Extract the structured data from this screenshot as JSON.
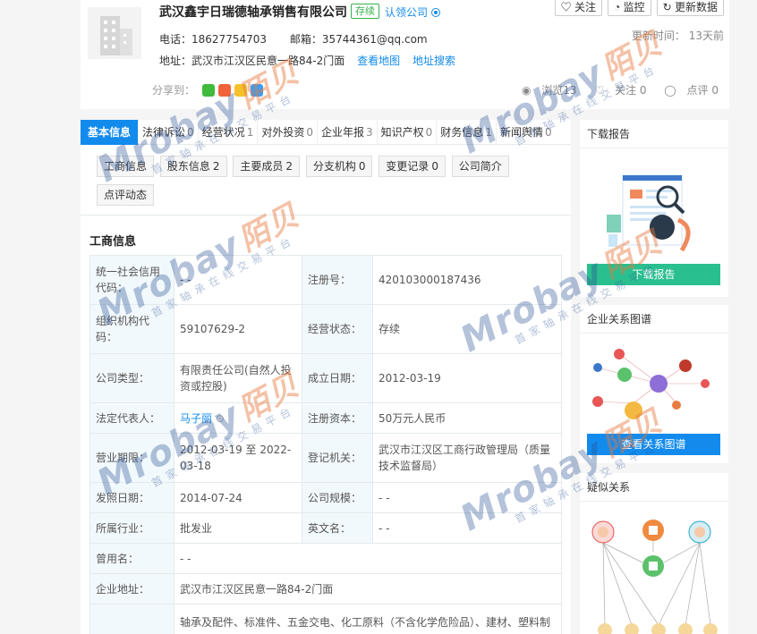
{
  "header": {
    "company_name": "武汉鑫宇日瑞德轴承销售有限公司",
    "status_tag": "存续",
    "claim_label": "认领公司",
    "phone_label": "电话：",
    "phone": "18627754703",
    "email_label": "邮箱：",
    "email": "35744361@qq.com",
    "address_label": "地址：",
    "address": "武汉市江汉区民意一路84-2门面",
    "view_map": "查看地图",
    "address_search": "地址搜索",
    "share_label": "分享到：",
    "buttons": {
      "follow": "关注",
      "monitor": "监控",
      "update": "更新数据"
    },
    "update_time_label": "更新时间：",
    "update_time": "13天前",
    "stats": {
      "views": "浏览13",
      "follows": "关注 0",
      "comments": "点评 0"
    }
  },
  "tabs": [
    {
      "label": "基本信息",
      "count": ""
    },
    {
      "label": "法律诉讼",
      "count": "0"
    },
    {
      "label": "经营状况",
      "count": "1"
    },
    {
      "label": "对外投资",
      "count": "0"
    },
    {
      "label": "企业年报",
      "count": "3"
    },
    {
      "label": "知识产权",
      "count": "0"
    },
    {
      "label": "财务信息",
      "count": "1"
    },
    {
      "label": "新闻舆情",
      "count": "0"
    }
  ],
  "subtabs": [
    {
      "label": "工商信息",
      "count": ""
    },
    {
      "label": "股东信息",
      "count": "2"
    },
    {
      "label": "主要成员",
      "count": "2"
    },
    {
      "label": "分支机构",
      "count": "0"
    },
    {
      "label": "变更记录",
      "count": "0"
    },
    {
      "label": "公司简介",
      "count": ""
    },
    {
      "label": "点评动态",
      "count": ""
    }
  ],
  "section_title": "工商信息",
  "info": {
    "credit_code_k": "统一社会信用代码：",
    "credit_code_v": "- -",
    "reg_no_k": "注册号：",
    "reg_no_v": "420103000187436",
    "org_code_k": "组织机构代码：",
    "org_code_v": "59107629-2",
    "status_k": "经营状态：",
    "status_v": "存续",
    "type_k": "公司类型：",
    "type_v": "有限责任公司(自然人投资或控股)",
    "found_k": "成立日期：",
    "found_v": "2012-03-19",
    "legal_k": "法定代表人：",
    "legal_v": "马子丽",
    "capital_k": "注册资本：",
    "capital_v": "50万元人民币",
    "term_k": "营业期限：",
    "term_v": "2012-03-19 至 2022-03-18",
    "authority_k": "登记机关：",
    "authority_v": "武汉市江汉区工商行政管理局（质量技术监督局）",
    "issue_k": "发照日期：",
    "issue_v": "2014-07-24",
    "scale_k": "公司规模：",
    "scale_v": "- -",
    "industry_k": "所属行业：",
    "industry_v": "批发业",
    "en_name_k": "英文名：",
    "en_name_v": "- -",
    "former_k": "曾用名：",
    "former_v": "- -",
    "addr_k": "企业地址：",
    "addr_v": "武汉市江汉区民意一路84-2门面",
    "scope_v": "轴承及配件、标准件、五金交电、化工原料（不含化学危险品）、建材、塑料制"
  },
  "right": {
    "report_title": "下载报告",
    "report_btn": "下载报告",
    "graph_title": "企业关系图谱",
    "graph_btn": "查看关系图谱",
    "similar_title": "疑似关系"
  },
  "watermark": {
    "brand": "Mrobay",
    "brand_cn": "陌贝",
    "slogan": "首家轴承在线交易平台"
  },
  "colors": {
    "primary": "#128bed",
    "status_green": "#37b24d",
    "report_btn": "#2abf8f"
  }
}
